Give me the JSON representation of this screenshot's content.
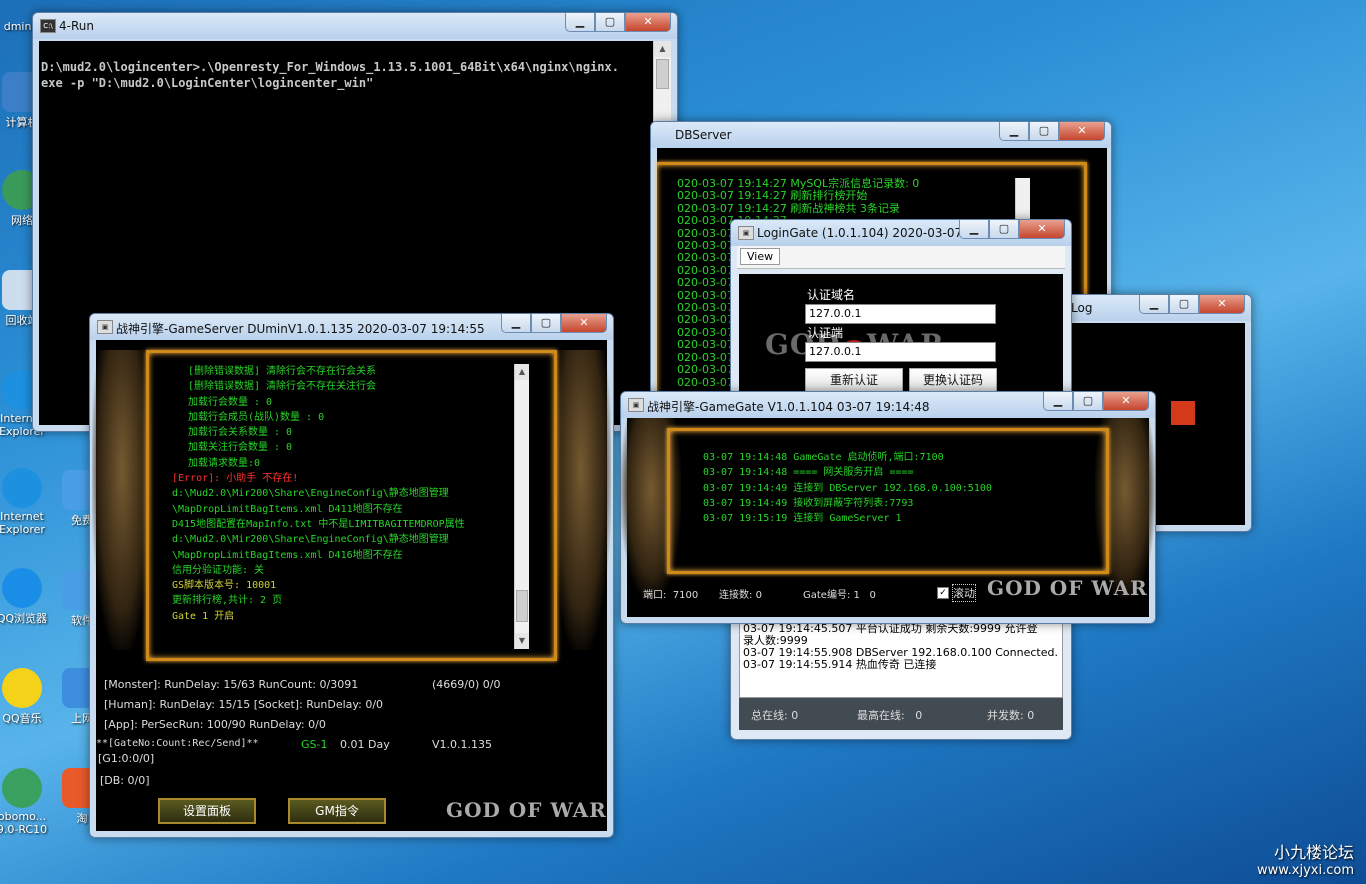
{
  "desktop": {
    "icons": [
      "dminis",
      "计算机",
      "网络",
      "回收站",
      "Internet Explorer",
      "Internet Explorer",
      "免费",
      "QQ浏览器",
      "软件",
      "QQ音乐",
      "上网",
      "obomo... 9.0-RC10",
      "淘"
    ],
    "watermark": "小九楼论坛",
    "watermark_url": "www.xjyxi.com"
  },
  "run": {
    "title": "4-Run",
    "lines": [
      "D:\\mud2.0\\logincenter>.\\Openresty_For_Windows_1.13.5.1001_64Bit\\x64\\nginx\\nginx.",
      "exe -p \"D:\\mud2.0\\LoginCenter\\logincenter_win\""
    ]
  },
  "dbserver": {
    "title": "DBServer",
    "lines": [
      "020-03-07 19:14:27 MySQL宗派信息记录数: 0",
      "020-03-07 19:14:27 刷新排行榜开始",
      "020-03-07 19:14:27 刷新战神榜共 3条记录",
      "020-03-07 19:14:27",
      "020-03-07 19:14:27",
      "020-03-07 19:14:27",
      "020-03-07 19:14:27",
      "020-03-07 19:14:27",
      "020-03-07 19:14:27",
      "020-03-07 19:14:27",
      "020-03-07 19:14:27",
      "020-03-07 19:14:27",
      "020-03-07 19:14:27",
      "020-03-07 19:14:27",
      "020-03-07 19:14:27",
      "020-03-07 19:14:27",
      "020-03-07 19:14:27"
    ]
  },
  "log": {
    "title": "Log"
  },
  "logingate": {
    "title": "LoginGate (1.0.1.104)  2020-03-07 1...",
    "menu_view": "View",
    "label1": "认证域名",
    "value1": "127.0.0.1",
    "label2": "认证端",
    "value2": "127.0.0.1",
    "btn1": "重新认证",
    "btn2": "更换认证码",
    "log": [
      "03-07 19:14:45.507 平台认证成功 剩余天数:9999 允许登",
      "录人数:9999",
      "03-07 19:14:55.908 DBServer 192.168.0.100 Connected.",
      "03-07 19:14:55.914 热血传奇 已连接"
    ],
    "total_label": "总在线:",
    "total": "0",
    "max_label": "最高在线:",
    "max": "0",
    "conc_label": "并发数:",
    "conc": "0"
  },
  "gamegate": {
    "title": "战神引擎-GameGate V1.0.1.104 03-07 19:14:48",
    "lines": [
      "03-07 19:14:48 GameGate 启动侦听,端口:7100",
      "03-07 19:14:48 ==== 网关服务开启 ====",
      "03-07 19:14:49 连接到 DBServer 192.168.0.100:5100",
      "03-07 19:14:49 接收到屏蔽字符列表:7793",
      "03-07 19:15:19 连接到 GameServer 1"
    ],
    "port_label": "端口:",
    "port": "7100",
    "conn_label": "连接数:",
    "conn": "0",
    "gate_label": "Gate编号:",
    "gate": "1",
    "gate_val": "0",
    "scroll_label": "滚动",
    "logo": "GOD OF WAR"
  },
  "gameserver": {
    "title": "战神引擎-GameServer DUminV1.0.1.135 2020-03-07 19:14:55",
    "lines": [
      {
        "t": "[删除错误数据] 清除行会不存在行会关系",
        "c": "g",
        "i": 1
      },
      {
        "t": "[删除错误数据] 清除行会不存在关注行会",
        "c": "g",
        "i": 1
      },
      {
        "t": "加载行会数量 : 0",
        "c": "g",
        "i": 1
      },
      {
        "t": "加载行会成员(战队)数量 : 0",
        "c": "g",
        "i": 1
      },
      {
        "t": "加载行会关系数量 : 0",
        "c": "g",
        "i": 1
      },
      {
        "t": "加载关注行会数量 : 0",
        "c": "g",
        "i": 1
      },
      {
        "t": "加载请求数量:0",
        "c": "g",
        "i": 1
      },
      {
        "t": "[Error]: 小助手 不存在!",
        "c": "r",
        "i": 0
      },
      {
        "t": "d:\\Mud2.0\\Mir200\\Share\\EngineConfig\\静态地图管理",
        "c": "g",
        "i": 0
      },
      {
        "t": "\\MapDropLimitBagItems.xml D411地图不存在",
        "c": "g",
        "i": 0
      },
      {
        "t": "D415地图配置在MapInfo.txt 中不是LIMITBAGITEMDROP属性",
        "c": "g",
        "i": 0
      },
      {
        "t": "d:\\Mud2.0\\Mir200\\Share\\EngineConfig\\静态地图管理",
        "c": "g",
        "i": 0
      },
      {
        "t": "\\MapDropLimitBagItems.xml D416地图不存在",
        "c": "g",
        "i": 0
      },
      {
        "t": "信用分验证功能: 关",
        "c": "g",
        "i": 0
      },
      {
        "t": "GS脚本版本号: 10001",
        "c": "y",
        "i": 0
      },
      {
        "t": "更新排行榜,共计: 2 页",
        "c": "g",
        "i": 0
      },
      {
        "t": "Gate 1 开启",
        "c": "y",
        "i": 0
      }
    ],
    "stat1": "[Monster]: RunDelay: 15/63  RunCount: 0/3091",
    "stat1b": "(4669/0) 0/0",
    "stat2": "[Human]: RunDelay: 15/15  [Socket]: RunDelay: 0/0",
    "stat3": "[App]: PerSecRun: 100/90  RunDelay: 0/0",
    "gate_line": "**[GateNo:Count:Rec/Send]**",
    "gs": "GS-1",
    "days": "0.01 Day",
    "ver": "V1.0.1.135",
    "g1": "[G1:0:0/0]",
    "db": "[DB: 0/0]",
    "btn_settings": "设置面板",
    "btn_gm": "GM指令",
    "logo": "GOD OF WAR"
  }
}
